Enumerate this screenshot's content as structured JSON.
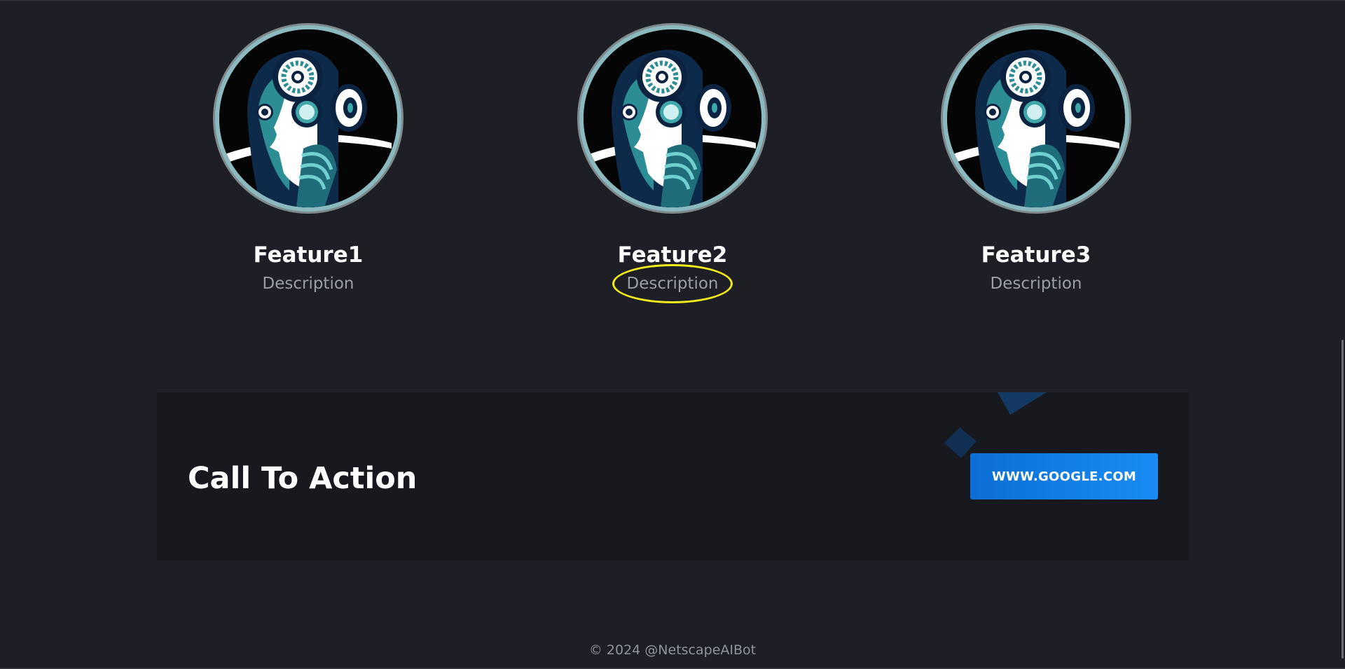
{
  "features": [
    {
      "title": "Feature1",
      "description": "Description",
      "icon": "robot-head-gears-icon"
    },
    {
      "title": "Feature2",
      "description": "Description",
      "icon": "robot-head-gears-icon"
    },
    {
      "title": "Feature3",
      "description": "Description",
      "icon": "robot-head-gears-icon"
    }
  ],
  "cta": {
    "title": "Call To Action",
    "button_label": "WWW.GOOGLE.COM"
  },
  "footer": {
    "text": "© 2024 @NetscapeAIBot"
  },
  "colors": {
    "background": "#1e1f26",
    "cta_background": "#18191e",
    "button_blue": "#1a8cf5",
    "highlight": "#f3ea1b",
    "avatar_ring": "#8ab9bf"
  }
}
